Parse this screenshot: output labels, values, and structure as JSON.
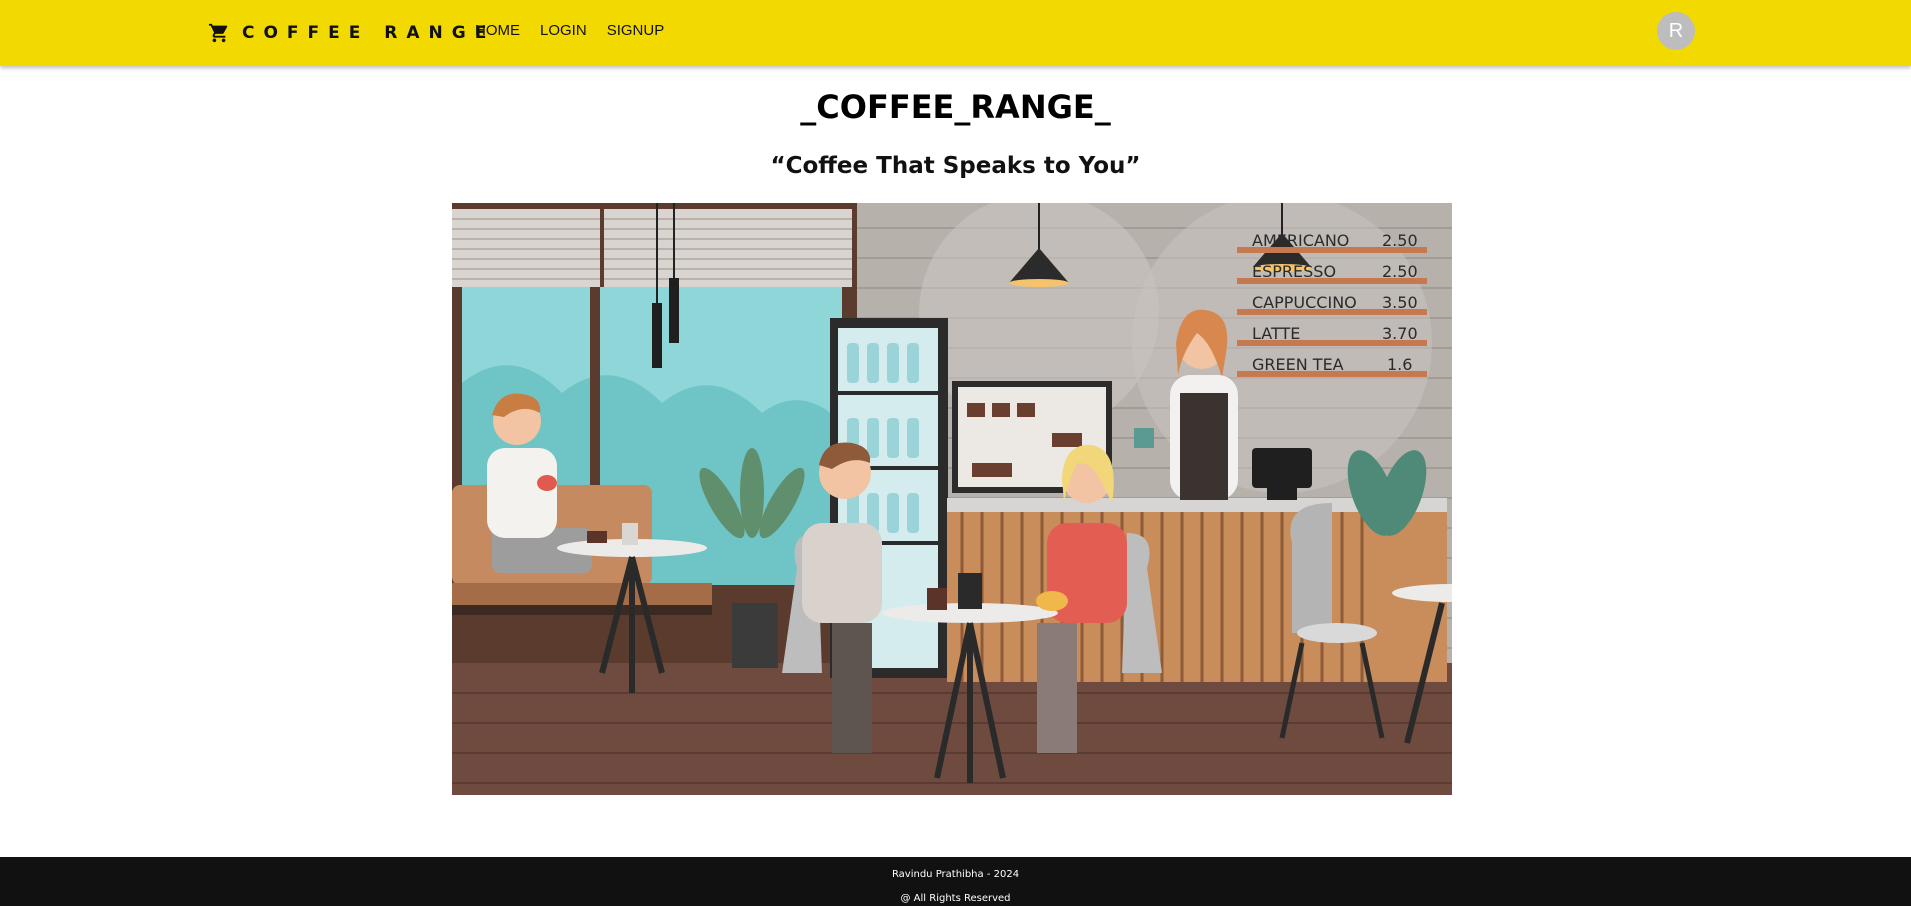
{
  "header": {
    "brand": "COFFEE RANGE",
    "nav": [
      {
        "label": "HOME"
      },
      {
        "label": "LOGIN"
      },
      {
        "label": "SIGNUP"
      }
    ],
    "avatar_initial": "R",
    "brand_color": "#f2da00"
  },
  "main": {
    "title": "_COFFEE_RANGE_",
    "tagline": "“Coffee That Speaks to You”",
    "menu_board": [
      {
        "item": "AMERICANO",
        "price": "2.50"
      },
      {
        "item": "ESPRESSO",
        "price": "2.50"
      },
      {
        "item": "CAPPUCCINO",
        "price": "3.50"
      },
      {
        "item": "LATTE",
        "price": "3.70"
      },
      {
        "item": "GREEN TEA",
        "price": "1.6"
      }
    ]
  },
  "footer": {
    "credit": "Ravindu Prathibha - 2024",
    "rights": "@ All Rights Reserved",
    "background": "#111111"
  }
}
